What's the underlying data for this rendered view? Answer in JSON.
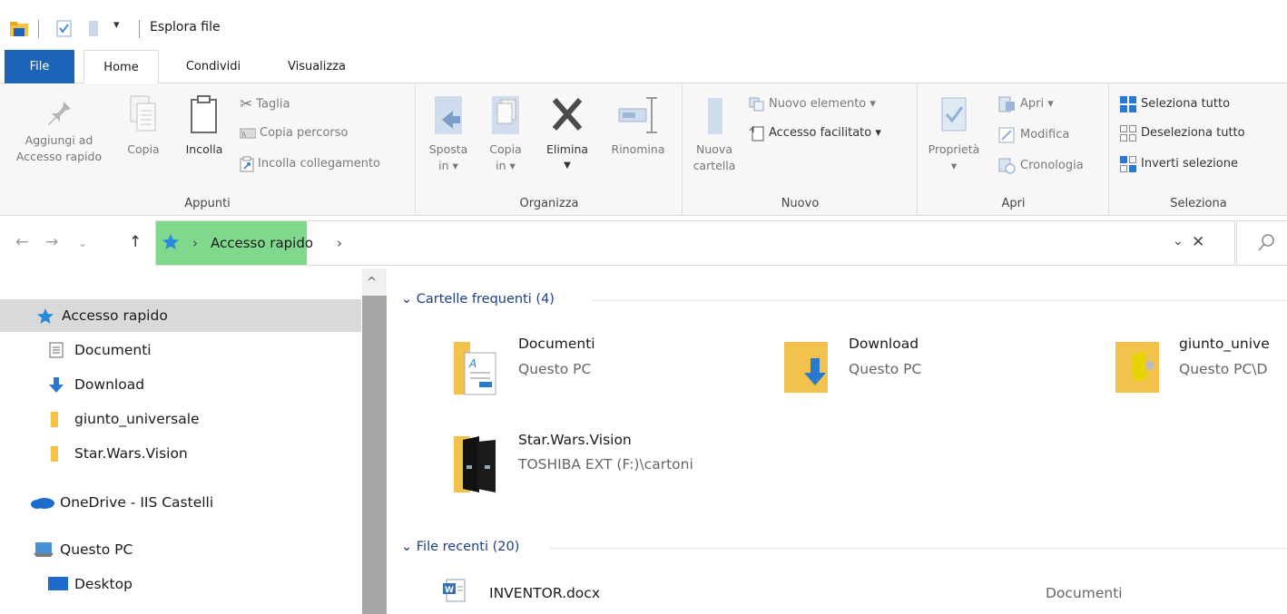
{
  "window": {
    "title": "Esplora file"
  },
  "tabs": {
    "file": "File",
    "home": "Home",
    "share": "Condividi",
    "view": "Visualizza"
  },
  "ribbon": {
    "clipboard": {
      "label": "Appunti",
      "pin_line1": "Aggiungi ad",
      "pin_line2": "Accesso rapido",
      "copy": "Copia",
      "paste": "Incolla",
      "cut": "Taglia",
      "copy_path": "Copia percorso",
      "paste_shortcut": "Incolla collegamento"
    },
    "organize": {
      "label": "Organizza",
      "move_line1": "Sposta",
      "move_line2": "in",
      "copy_line1": "Copia",
      "copy_line2": "in",
      "delete": "Elimina",
      "rename": "Rinomina"
    },
    "new": {
      "label": "Nuovo",
      "folder_line1": "Nuova",
      "folder_line2": "cartella",
      "new_item": "Nuovo elemento",
      "easy_access": "Accesso facilitato"
    },
    "open": {
      "label": "Apri",
      "properties": "Proprietà",
      "open": "Apri",
      "edit": "Modifica",
      "history": "Cronologia"
    },
    "select": {
      "label": "Seleziona",
      "select_all": "Seleziona tutto",
      "select_none": "Deseleziona tutto",
      "invert": "Inverti selezione"
    }
  },
  "nav": {
    "path": "Accesso rapido"
  },
  "sidebar": {
    "items": [
      {
        "label": "Accesso rapido",
        "icon": "star-icon"
      },
      {
        "label": "Documenti",
        "icon": "documents-icon"
      },
      {
        "label": "Download",
        "icon": "download-icon"
      },
      {
        "label": "giunto_universale",
        "icon": "folder-icon"
      },
      {
        "label": "Star.Wars.Vision",
        "icon": "folder-icon"
      },
      {
        "label": "OneDrive - IIS Castelli",
        "icon": "onedrive-icon"
      },
      {
        "label": "Questo PC",
        "icon": "pc-icon"
      },
      {
        "label": "Desktop",
        "icon": "desktop-icon"
      }
    ]
  },
  "main": {
    "frequent_header": "Cartelle frequenti (4)",
    "folders": [
      {
        "name": "Documenti",
        "location": "Questo PC"
      },
      {
        "name": "Download",
        "location": "Questo PC"
      },
      {
        "name": "giunto_unive",
        "location": "Questo PC\\D"
      },
      {
        "name": "Star.Wars.Vision",
        "location": "TOSHIBA EXT (F:)\\cartoni"
      }
    ],
    "recent_header": "File recenti (20)",
    "files": [
      {
        "name": "INVENTOR.docx",
        "location": "Documenti"
      }
    ]
  },
  "colors": {
    "accent": "#1d63b8",
    "path_highlight": "#7fd88b",
    "selection": "#d9d9d9",
    "section_header": "#1e3e8a"
  }
}
